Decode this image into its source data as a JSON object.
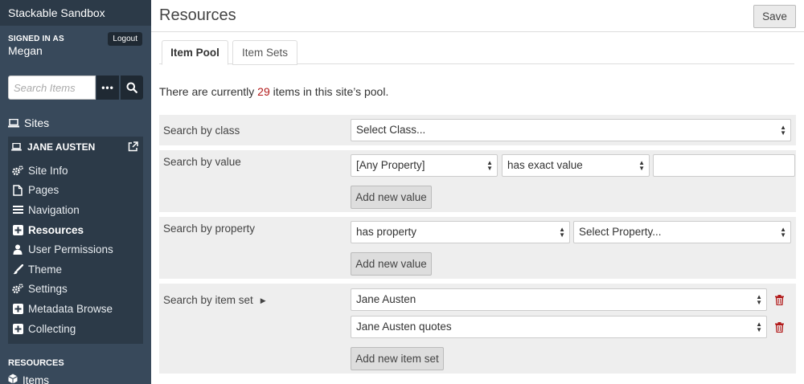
{
  "sidebar": {
    "site_title": "Stackable Sandbox",
    "signed_in_label": "SIGNED IN AS",
    "user_name": "Megan",
    "logout_label": "Logout",
    "search_placeholder": "Search Items",
    "sites_label": "Sites",
    "site_name": "JANE AUSTEN",
    "nav_items": [
      {
        "label": "Site Info",
        "icon": "gears-icon"
      },
      {
        "label": "Pages",
        "icon": "page-icon"
      },
      {
        "label": "Navigation",
        "icon": "bars-icon"
      },
      {
        "label": "Resources",
        "icon": "plus-square-icon",
        "active": true
      },
      {
        "label": "User Permissions",
        "icon": "user-icon"
      },
      {
        "label": "Theme",
        "icon": "brush-icon"
      },
      {
        "label": "Settings",
        "icon": "gears-icon"
      },
      {
        "label": "Metadata Browse",
        "icon": "plus-square-icon"
      },
      {
        "label": "Collecting",
        "icon": "plus-square-icon"
      }
    ],
    "resources_label": "RESOURCES",
    "items_label": "Items"
  },
  "header": {
    "title": "Resources",
    "save_label": "Save"
  },
  "tabs": [
    "Item Pool",
    "Item Sets"
  ],
  "pool": {
    "prefix": "There are currently",
    "count": "29",
    "suffix": "items in this site’s pool."
  },
  "search_class": {
    "label": "Search by class",
    "select_value": "Select Class..."
  },
  "search_value": {
    "label": "Search by value",
    "property_select": "[Any Property]",
    "type_select": "has exact value",
    "value_input": "",
    "add_button": "Add new value"
  },
  "search_property": {
    "label": "Search by property",
    "type_select": "has property",
    "property_select": "Select Property...",
    "add_button": "Add new value"
  },
  "search_item_set": {
    "label": "Search by item set",
    "sets": [
      "Jane Austen",
      "Jane Austen quotes"
    ],
    "add_button": "Add new item set"
  },
  "colors": {
    "sidebar_bg": "#38495b",
    "sidebar_dark": "#2c3a48",
    "count_color": "#b21a1a",
    "trash_color": "#b21a1a"
  }
}
